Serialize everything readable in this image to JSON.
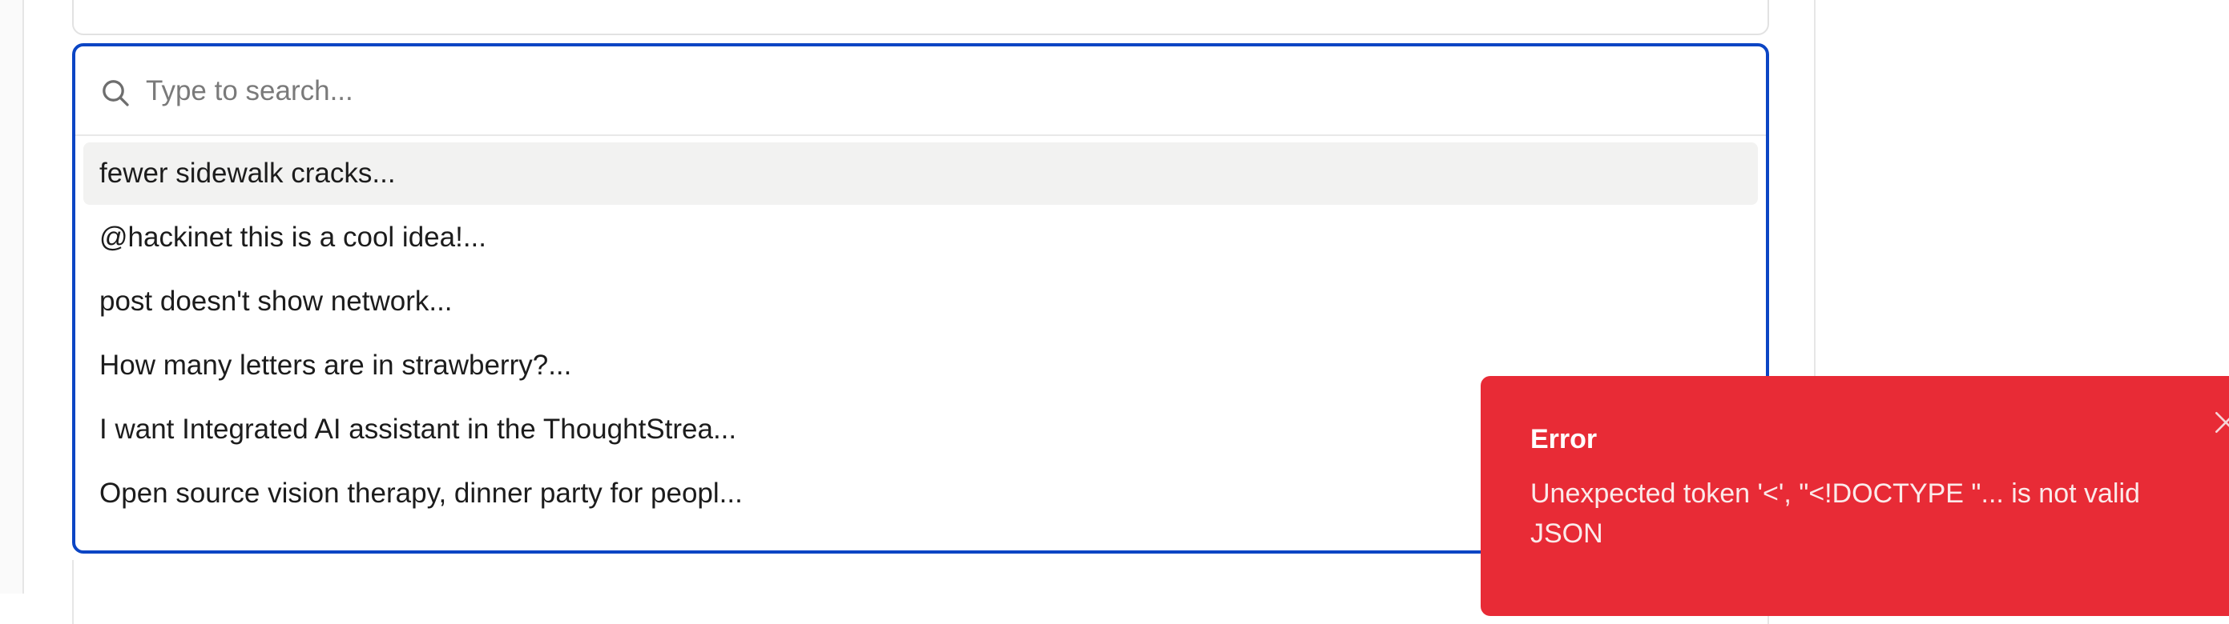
{
  "search": {
    "placeholder": "Type to search...",
    "value": ""
  },
  "results": [
    {
      "label": "fewer sidewalk cracks...",
      "active": true
    },
    {
      "label": "@hackinet this is a cool idea!...",
      "active": false
    },
    {
      "label": "post doesn't show network...",
      "active": false
    },
    {
      "label": "How many letters are in strawberry?...",
      "active": false
    },
    {
      "label": "I want Integrated AI assistant in the ThoughtStrea...",
      "active": false
    },
    {
      "label": "Open source vision therapy, dinner party for peopl...",
      "active": false
    }
  ],
  "toast": {
    "title": "Error",
    "message": "Unexpected token '<', \"<!DOCTYPE \"... is not valid JSON",
    "background_color": "#e82b36"
  },
  "colors": {
    "focus_border": "#0b45c4",
    "highlight_row": "#f2f2f1"
  }
}
